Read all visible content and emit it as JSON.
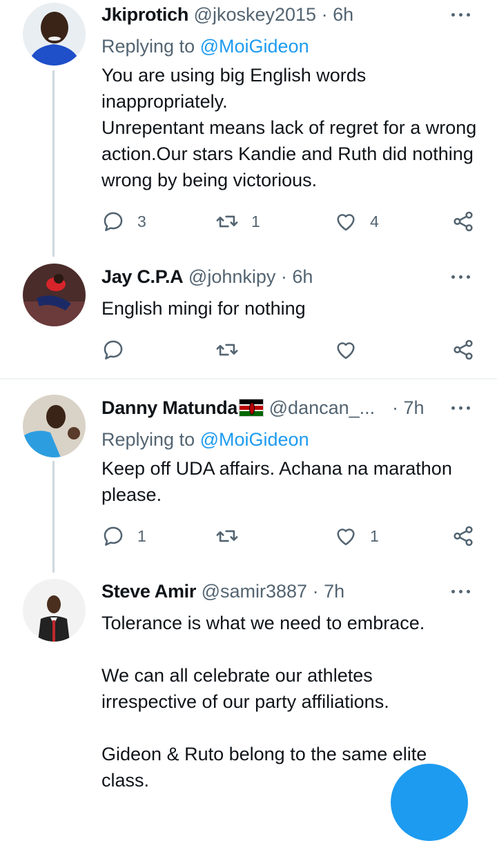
{
  "colors": {
    "accent": "#1d9bf0",
    "text_primary": "#0f1419",
    "text_secondary": "#536471",
    "thread_line": "#cfd9de"
  },
  "tweets": [
    {
      "name": "Jkiprotich",
      "handle": "@jkoskey2015",
      "time": "· 6h",
      "replying_prefix": "Replying to",
      "replying_to": "@MoiGideon",
      "text": "You are using big English words inappropriately.\nUnrepentant means lack of regret for a wrong action.Our stars Kandie and Ruth did nothing wrong by being victorious.",
      "replies": "3",
      "retweets": "1",
      "likes": "4"
    },
    {
      "name": "Jay C.P.A",
      "handle": "@johnkipy",
      "time": "· 6h",
      "text": "English mingi for nothing",
      "replies": "",
      "retweets": "",
      "likes": ""
    },
    {
      "name": "Danny Matunda",
      "name_flag": "kenya-flag-icon",
      "handle": "@dancan_...",
      "time": "· 7h",
      "replying_prefix": "Replying to",
      "replying_to": "@MoiGideon",
      "text": "Keep off UDA affairs. Achana na marathon please.",
      "replies": "1",
      "retweets": "",
      "likes": "1"
    },
    {
      "name": "Steve Amir",
      "handle": "@samir3887",
      "time": "· 7h",
      "text": "Tolerance is what we need to embrace.\n\nWe can all celebrate our athletes irrespective of our party affiliations.\n\nGideon & Ruto belong to the same elite class."
    }
  ],
  "icons": {
    "reply": "reply-icon",
    "retweet": "retweet-icon",
    "like": "heart-icon",
    "share": "share-icon",
    "more": "more-options-icon",
    "compose": "compose-fab"
  }
}
